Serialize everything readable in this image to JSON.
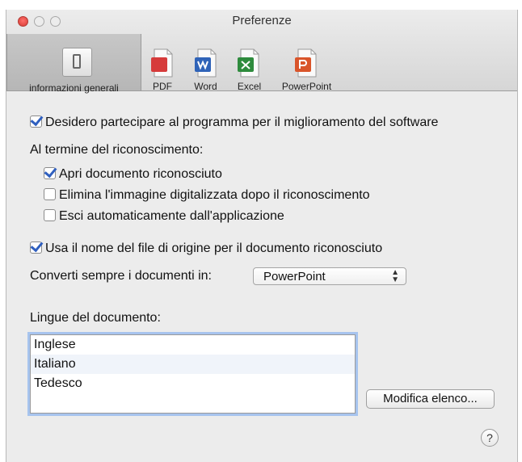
{
  "window": {
    "title": "Preferenze"
  },
  "toolbar": {
    "tabs": [
      {
        "label": "informazioni generali",
        "icon": "general-settings-icon",
        "active": true
      },
      {
        "label": "PDF",
        "icon": "pdf-document-icon",
        "color": "#d63b3b"
      },
      {
        "label": "Word",
        "icon": "word-document-icon",
        "color": "#2f63b8"
      },
      {
        "label": "Excel",
        "icon": "excel-document-icon",
        "color": "#2e8b3d"
      },
      {
        "label": "PowerPoint",
        "icon": "powerpoint-document-icon",
        "color": "#d9552b"
      }
    ]
  },
  "options": {
    "improvement": {
      "label": "Desidero partecipare al programma per il miglioramento del software",
      "checked": true
    },
    "after_recognition_label": "Al termine del riconoscimento:",
    "open_doc": {
      "label": "Apri documento riconosciuto",
      "checked": true
    },
    "delete_image": {
      "label": "Elimina l'immagine digitalizzata dopo il riconoscimento",
      "checked": false
    },
    "quit_app": {
      "label": "Esci automaticamente dall'applicazione",
      "checked": false
    },
    "use_filename": {
      "label": "Usa il nome del file di origine per il documento riconosciuto",
      "checked": true
    },
    "convert_label": "Converti sempre i documenti in:",
    "convert_value": "PowerPoint"
  },
  "languages": {
    "label": "Lingue del documento:",
    "items": [
      "Inglese",
      "Italiano",
      "Tedesco"
    ]
  },
  "buttons": {
    "edit_list": "Modifica elenco...",
    "help": "?"
  }
}
